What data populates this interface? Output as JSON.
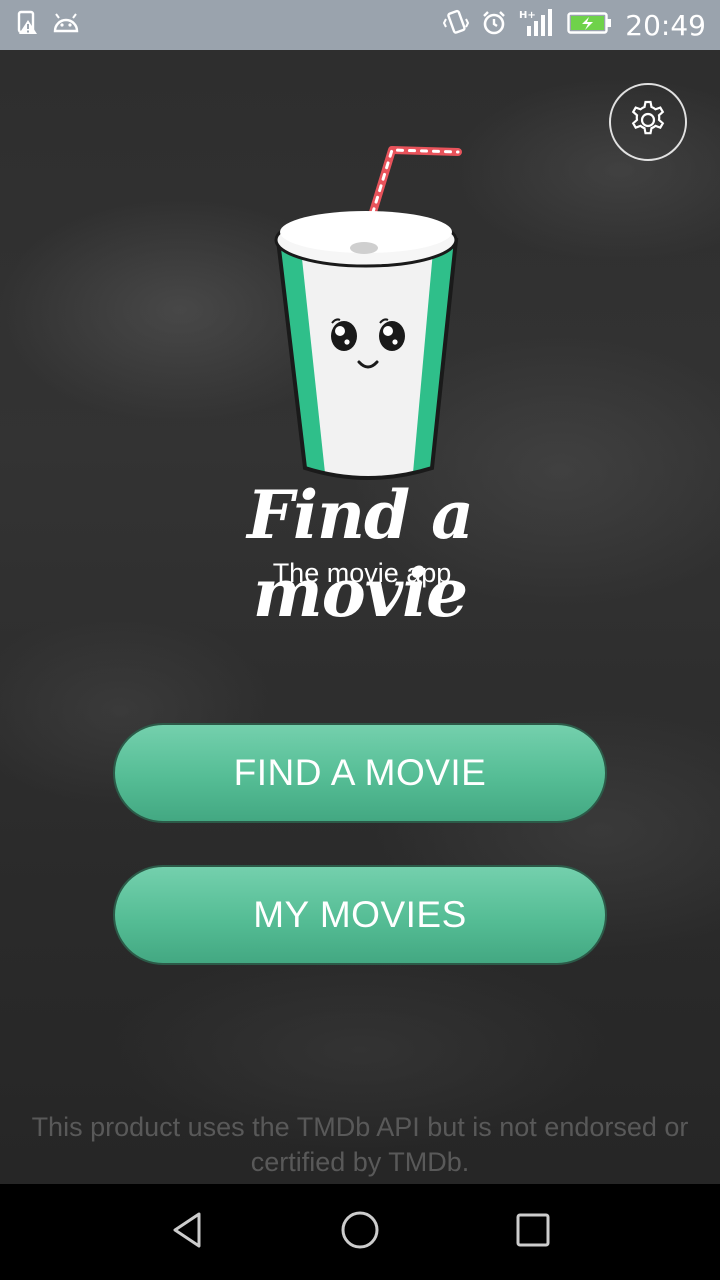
{
  "status_bar": {
    "time": "20:49",
    "icons": [
      "sim-alert-icon",
      "android-icon",
      "vibrate-icon",
      "alarm-icon",
      "signal-h-plus-icon",
      "battery-charging-icon"
    ]
  },
  "app": {
    "settings_icon": "gear-icon",
    "logo": {
      "title": "Find a movie",
      "subtitle": "The movie app"
    },
    "buttons": {
      "find_label": "FIND A MOVIE",
      "my_label": "MY MOVIES"
    },
    "disclaimer": "This product uses the TMDb API but is not endorsed or certified by TMDb.",
    "colors": {
      "accent": "#5cc49c",
      "cup_stripe": "#2fbf8a",
      "straw": "#e8535b"
    }
  },
  "nav_bar": {
    "icons": [
      "back-icon",
      "home-icon",
      "recents-icon"
    ]
  }
}
